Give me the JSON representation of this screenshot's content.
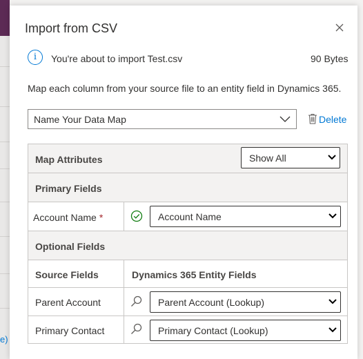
{
  "dialog": {
    "title": "Import from CSV",
    "info_text": "You're about to import Test.csv",
    "file_size": "90 Bytes",
    "description": "Map each column from your source file to an entity field in Dynamics 365.",
    "data_map": {
      "value": "Name Your Data Map"
    },
    "delete_label": "Delete"
  },
  "mapping_table": {
    "header": {
      "label": "Map Attributes",
      "filter_value": "Show All"
    },
    "primary_section": "Primary Fields",
    "primary_rows": [
      {
        "source": "Account Name",
        "required_marker": "*",
        "target": "Account Name",
        "status_icon": "check-circle-icon"
      }
    ],
    "optional_section": "Optional Fields",
    "columns": {
      "source": "Source Fields",
      "target": "Dynamics 365 Entity Fields"
    },
    "optional_rows": [
      {
        "source": "Parent Account",
        "target": "Parent Account (Lookup)",
        "status_icon": "search-icon"
      },
      {
        "source": "Primary Contact",
        "target": "Primary Contact (Lookup)",
        "status_icon": "search-icon"
      }
    ]
  },
  "background": {
    "link_fragment": "e)"
  },
  "colors": {
    "accent": "#0078d4",
    "required": "#a4262c",
    "success": "#107c10",
    "brand": "#5c2a55"
  }
}
